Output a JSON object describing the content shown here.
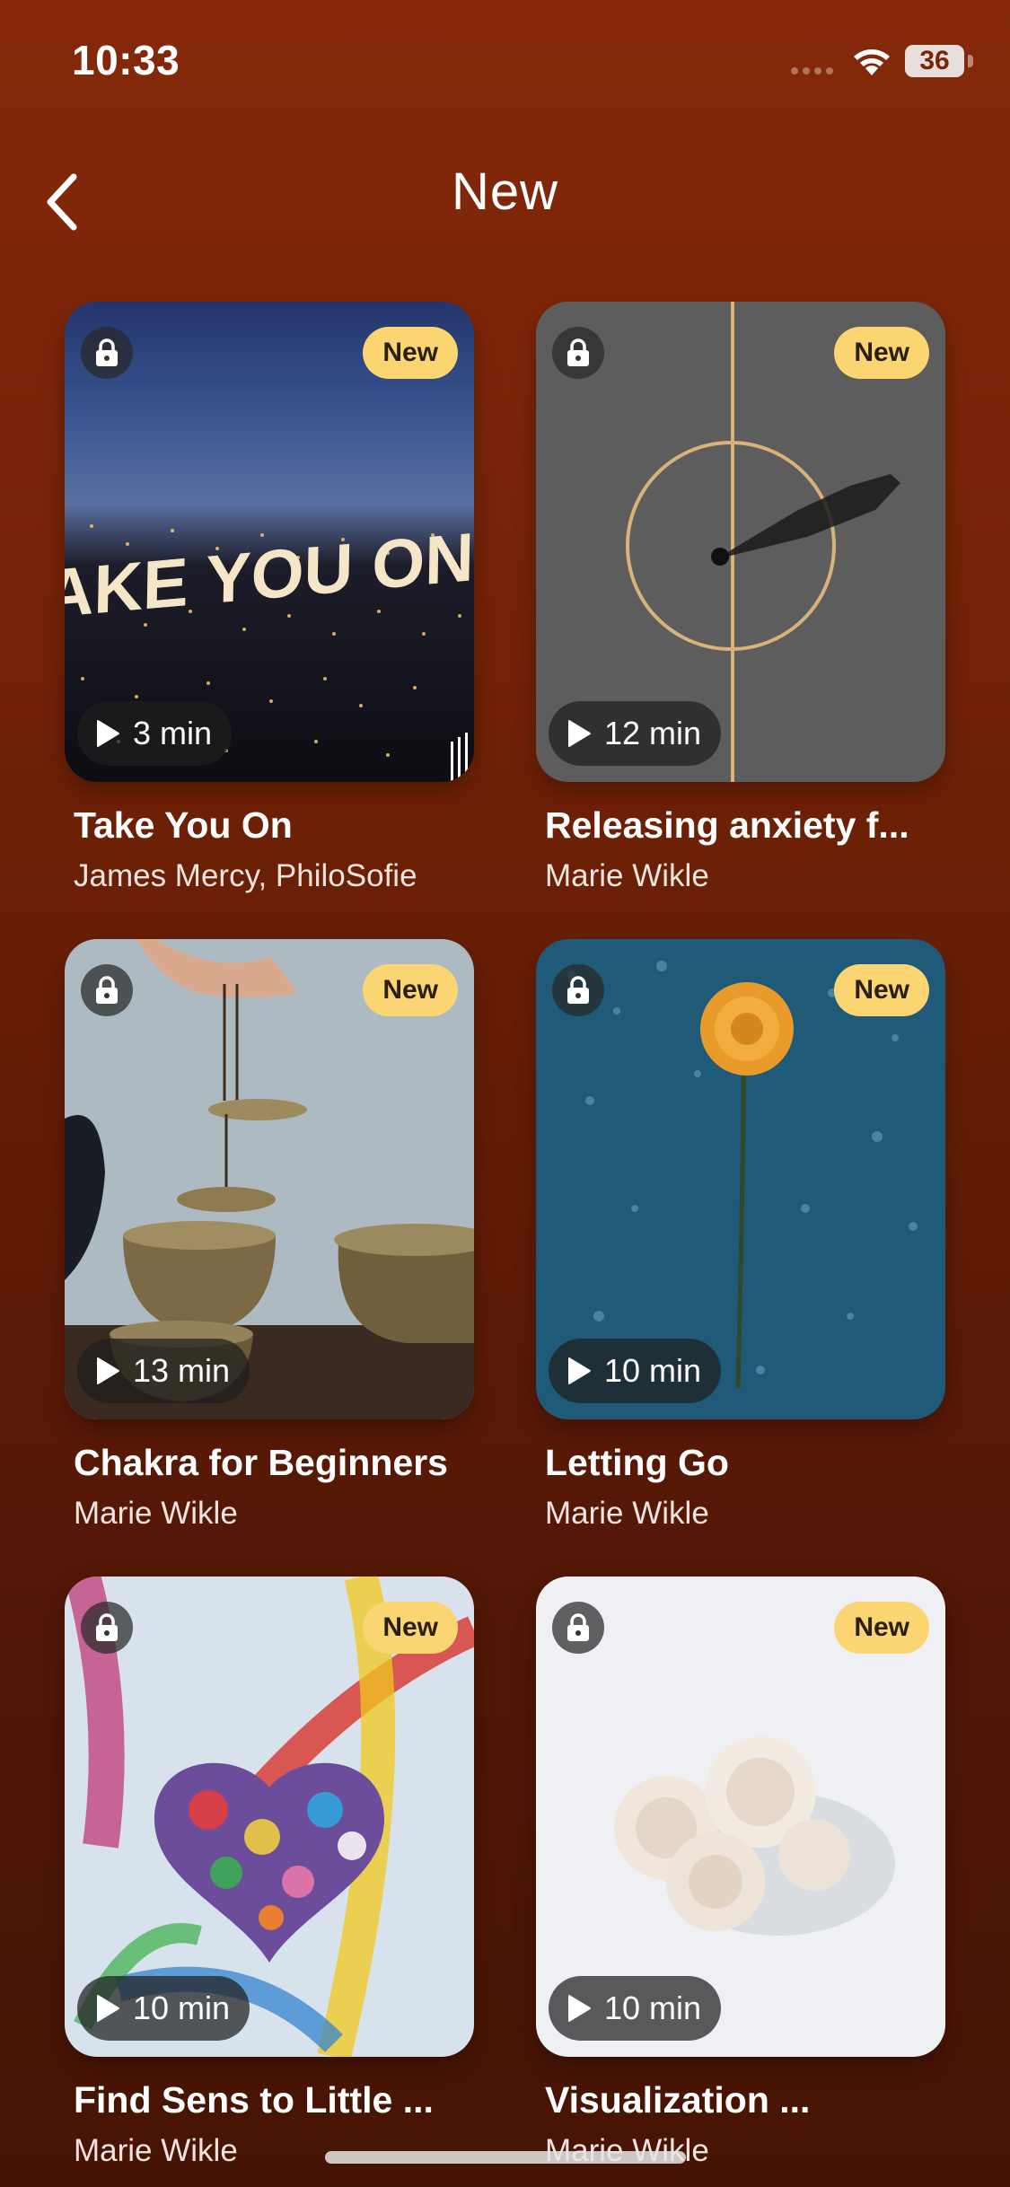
{
  "status_bar": {
    "time": "10:33",
    "battery": "36"
  },
  "header": {
    "title": "New"
  },
  "cards": [
    {
      "badge": "New",
      "duration": "3 min",
      "title": "Take You On",
      "subtitle": "James Mercy, PhiloSofie",
      "art_text": "TAKE YOU ON"
    },
    {
      "badge": "New",
      "duration": "12 min",
      "title": "Releasing anxiety f...",
      "subtitle": "Marie Wikle"
    },
    {
      "badge": "New",
      "duration": "13 min",
      "title": "Chakra for Beginners",
      "subtitle": "Marie Wikle"
    },
    {
      "badge": "New",
      "duration": "10 min",
      "title": "Letting Go",
      "subtitle": "Marie Wikle"
    },
    {
      "badge": "New",
      "duration": "10 min",
      "title": "Find Sens to Little ...",
      "subtitle": "Marie Wikle"
    },
    {
      "badge": "New",
      "duration": "10 min",
      "title": "Visualization ...",
      "subtitle": "Marie Wikle"
    }
  ],
  "icons": {
    "back": "chevron-left-icon",
    "lock": "lock-icon",
    "play": "play-icon",
    "wifi": "wifi-icon",
    "signal": "signal-icon",
    "battery": "battery-icon"
  },
  "colors": {
    "background_top": "#86290b",
    "background_bottom": "#461405",
    "new_badge": "#fcd573"
  }
}
